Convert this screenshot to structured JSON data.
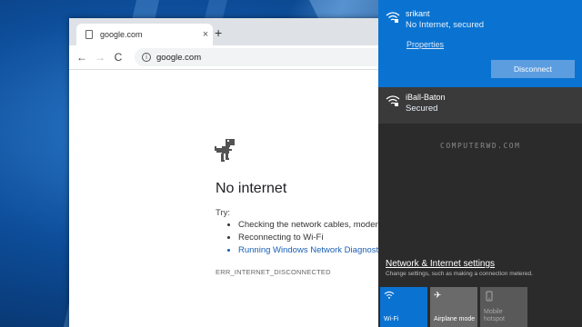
{
  "browser": {
    "tab_title": "google.com",
    "tab_close": "×",
    "new_tab": "+",
    "url": "google.com",
    "nav": {
      "back": "←",
      "forward": "→",
      "reload": "C"
    },
    "error": {
      "title": "No internet",
      "try": "Try:",
      "suggestions": [
        "Checking the network cables, modem",
        "Reconnecting to Wi-Fi",
        "Running Windows Network Diagnosti"
      ],
      "code": "ERR_INTERNET_DISCONNECTED"
    }
  },
  "flyout": {
    "networks": [
      {
        "ssid": "srikant",
        "status": "No Internet, secured",
        "properties": "Properties",
        "action": "Disconnect"
      },
      {
        "ssid": "iBall-Baton",
        "status": "Secured"
      }
    ],
    "watermark": "COMPUTERWD.COM",
    "settings_link": "Network & Internet settings",
    "settings_sub": "Change settings, such as making a connection metered.",
    "quick_actions": [
      {
        "label": "Wi-Fi",
        "icon": "wifi-icon",
        "active": true
      },
      {
        "label": "Airplane mode",
        "icon": "airplane-icon",
        "active": false
      },
      {
        "label": "Mobile hotspot",
        "icon": "hotspot-icon",
        "active": false,
        "disabled": true
      }
    ]
  },
  "colors": {
    "accent": "#0a73d1",
    "flyout_bg": "#2b2b2b",
    "link": "#1a5fb4"
  }
}
